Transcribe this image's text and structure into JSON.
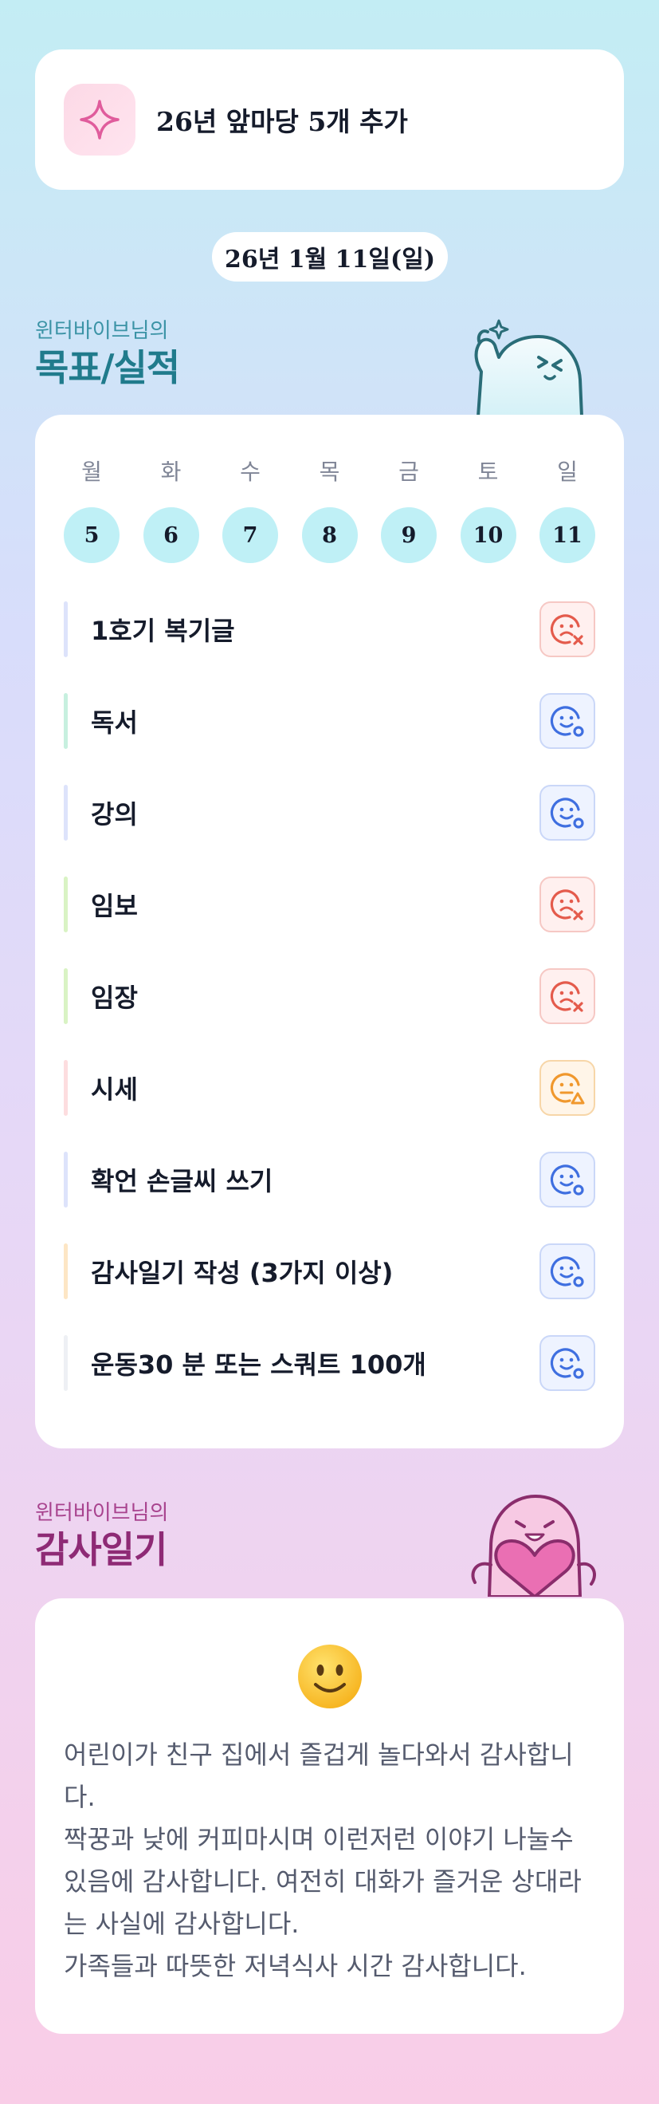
{
  "banner": {
    "icon": "sparkle-icon",
    "text": "26년 앞마당 5개 추가"
  },
  "date_label": "26년 1월 11일(일)",
  "goal_section": {
    "subtitle": "윈터바이브님의",
    "title": "목표/실적"
  },
  "week": {
    "days": [
      "월",
      "화",
      "수",
      "목",
      "금",
      "토",
      "일"
    ],
    "dates": [
      "5",
      "6",
      "7",
      "8",
      "9",
      "10",
      "11"
    ]
  },
  "goals": [
    {
      "label": "1호기 복기글",
      "status": "fail",
      "icon": "sad-x-icon",
      "accent": "#dde3fb"
    },
    {
      "label": "독서",
      "status": "ok",
      "icon": "smile-circle-icon",
      "accent": "#c7f0df"
    },
    {
      "label": "강의",
      "status": "ok",
      "icon": "smile-circle-icon",
      "accent": "#dde3fb"
    },
    {
      "label": "임보",
      "status": "fail",
      "icon": "sad-x-icon",
      "accent": "#d9f3c4"
    },
    {
      "label": "임장",
      "status": "fail",
      "icon": "sad-x-icon",
      "accent": "#d9f3c4"
    },
    {
      "label": "시세",
      "status": "warn",
      "icon": "meh-warning-icon",
      "accent": "#fddddf"
    },
    {
      "label": "확언 손글씨 쓰기",
      "status": "ok",
      "icon": "smile-circle-icon",
      "accent": "#dde3fb"
    },
    {
      "label": "감사일기 작성 (3가지 이상)",
      "status": "ok",
      "icon": "smile-circle-icon",
      "accent": "#fde6c5"
    },
    {
      "label": "운동30 분 또는 스쿼트 100개",
      "status": "ok",
      "icon": "smile-circle-icon",
      "accent": "#eef0f4"
    }
  ],
  "diary_section": {
    "subtitle": "윈터바이브님의",
    "title": "감사일기"
  },
  "diary": {
    "emoji": "smiley-face-icon",
    "text": "어린이가 친구 집에서 즐겁게 놀다와서 감사합니다.\n짝꿍과 낮에 커피마시며 이런저런 이야기 나눌수 있음에 감사합니다. 여전히 대화가 즐거운 상대라는 사실에 감사합니다.\n가족들과 따뜻한 저녁식사 시간 감사합니다."
  },
  "colors": {
    "fail": "#e45b4c",
    "ok": "#3f6fe0",
    "warn": "#f0982d"
  }
}
